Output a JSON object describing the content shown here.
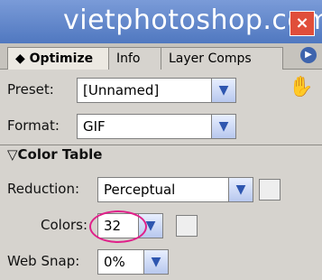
{
  "title": "vietphotoshop.com",
  "tabs": [
    "◆ Optimize",
    "Info",
    "Layer Comps"
  ],
  "preset": {
    "label": "Preset:",
    "value": "[Unnamed]"
  },
  "format": {
    "label": "Format:",
    "value": "GIF"
  },
  "color_table": {
    "title": "▽Color Table"
  },
  "reduction": {
    "label": "Reduction:",
    "value": "Perceptual"
  },
  "colors": {
    "label": "Colors:",
    "value": "32"
  },
  "web_snap": {
    "label": "Web Snap:",
    "value": "0%"
  },
  "icons": {
    "close": "close-icon",
    "menu": "panel-menu-icon",
    "optimize": "optimize-icon",
    "square": "swatch-icon"
  }
}
